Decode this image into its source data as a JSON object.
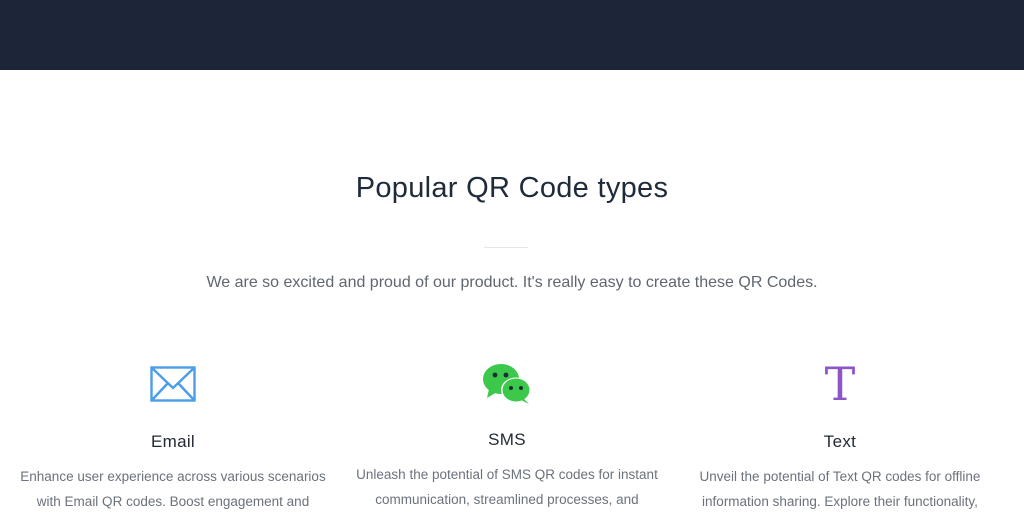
{
  "header": {},
  "section": {
    "title": "Popular QR Code types",
    "subtitle": "We are so excited and proud of our product. It's really easy to create these QR Codes."
  },
  "cards": [
    {
      "icon": "envelope-icon",
      "title": "Email",
      "text": "Enhance user experience across various scenarios with Email QR codes. Boost engagement and"
    },
    {
      "icon": "chat-bubbles-icon",
      "title": "SMS",
      "text": "Unleash the potential of SMS QR codes for instant communication, streamlined processes, and"
    },
    {
      "icon": "text-icon",
      "glyph": "T",
      "title": "Text",
      "text": "Unveil the potential of Text QR codes for offline information sharing. Explore their functionality,"
    }
  ],
  "colors": {
    "header_bg": "#1d2538",
    "email_icon": "#4a9de8",
    "sms_icon": "#3cc84a",
    "text_icon": "#8e55c9"
  }
}
